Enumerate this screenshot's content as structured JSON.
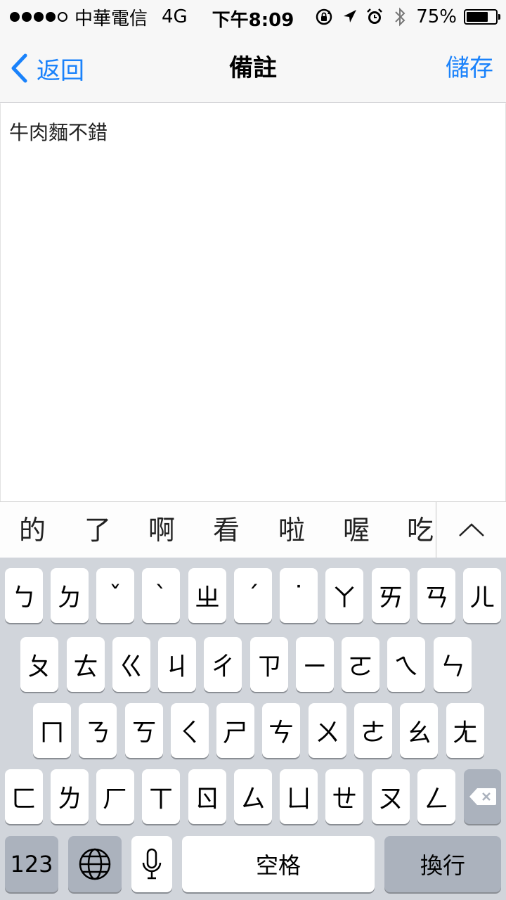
{
  "status_bar": {
    "carrier": "中華電信",
    "network": "4G",
    "time": "下午8:09",
    "battery": "75%",
    "battery_level": 0.75,
    "signal_bars": 4,
    "icons": [
      "rotation-lock-icon",
      "location-arrow-icon",
      "alarm-icon",
      "bluetooth-icon",
      "battery-icon"
    ]
  },
  "nav": {
    "back_label": "返回",
    "title": "備註",
    "save_label": "儲存",
    "accent_color": "#1a82fb"
  },
  "note": {
    "text": "牛肉麵不錯"
  },
  "suggestions": {
    "items": [
      "的",
      "了",
      "啊",
      "看",
      "啦",
      "喔",
      "吃"
    ],
    "expand_icon": "chevron-up-icon"
  },
  "keyboard": {
    "rows": [
      [
        "ㄅ",
        "ㄉ",
        "ˇ",
        "ˋ",
        "ㄓ",
        "ˊ",
        "˙",
        "ㄚ",
        "ㄞ",
        "ㄢ",
        "ㄦ"
      ],
      [
        "ㄆ",
        "ㄊ",
        "ㄍ",
        "ㄐ",
        "ㄔ",
        "ㄗ",
        "ㄧ",
        "ㄛ",
        "ㄟ",
        "ㄣ"
      ],
      [
        "ㄇ",
        "ㄋ",
        "ㄎ",
        "ㄑ",
        "ㄕ",
        "ㄘ",
        "ㄨ",
        "ㄜ",
        "ㄠ",
        "ㄤ"
      ],
      [
        "ㄈ",
        "ㄌ",
        "ㄏ",
        "ㄒ",
        "ㄖ",
        "ㄙ",
        "ㄩ",
        "ㄝ",
        "ㄡ",
        "ㄥ"
      ]
    ],
    "numbers_label": "123",
    "space_label": "空格",
    "return_label": "換行",
    "globe_icon": "globe-icon",
    "mic_icon": "microphone-icon",
    "delete_icon": "delete-icon",
    "background_color": "#d1d5db"
  }
}
